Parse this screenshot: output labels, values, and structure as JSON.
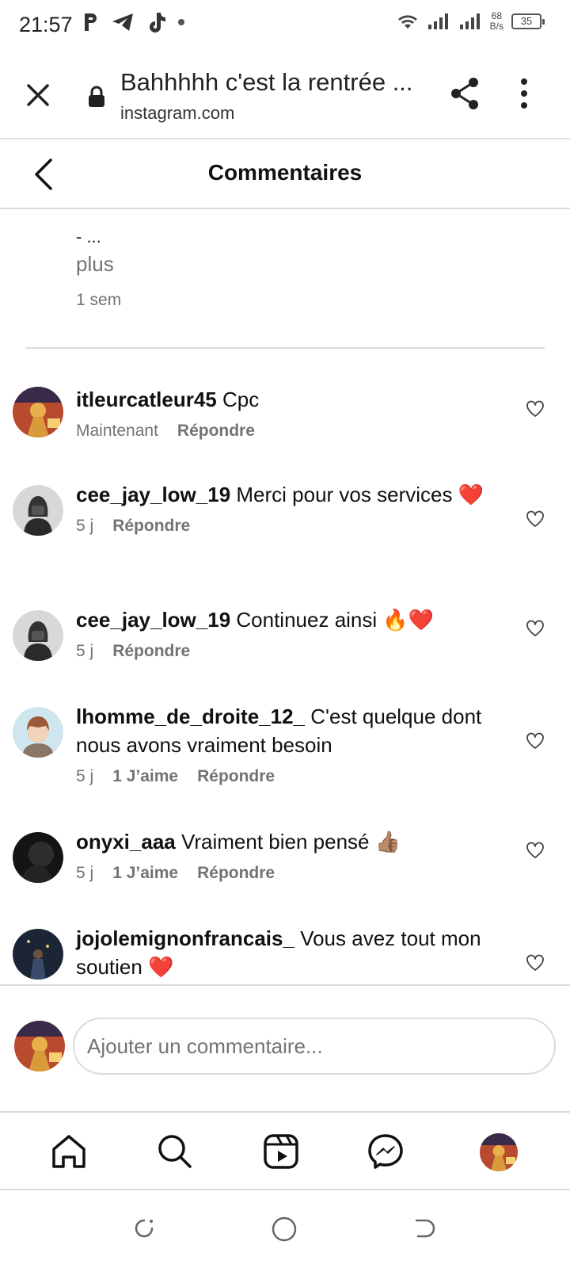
{
  "status_bar": {
    "time": "21:57",
    "net_speed_value": "68",
    "net_speed_unit": "B/s",
    "battery": "35"
  },
  "browser": {
    "page_title": "Bahhhhh c'est la rentrée ...",
    "domain": "instagram.com"
  },
  "header": {
    "title": "Commentaires"
  },
  "caption": {
    "snippet": "- ...",
    "more_label": "plus",
    "time": "1 sem"
  },
  "comments": [
    {
      "username": "itleurcatleur45",
      "text": "Cpc",
      "time": "Maintenant",
      "likes": "",
      "reply_label": "Répondre"
    },
    {
      "username": "cee_jay_low_19",
      "text": "Merci pour vos services ❤️",
      "time": "5 j",
      "likes": "",
      "reply_label": "Répondre"
    },
    {
      "username": "cee_jay_low_19",
      "text": "Continuez ainsi 🔥❤️",
      "time": "5 j",
      "likes": "",
      "reply_label": "Répondre"
    },
    {
      "username": "lhomme_de_droite_12_",
      "text": "C'est quelque dont nous avons vraiment besoin",
      "time": "5 j",
      "likes": "1 J’aime",
      "reply_label": "Répondre"
    },
    {
      "username": "onyxi_aaa",
      "text": "Vraiment bien pensé 👍🏽",
      "time": "5 j",
      "likes": "1 J’aime",
      "reply_label": "Répondre"
    },
    {
      "username": "jojolemignonfrancais_",
      "text": "Vous avez tout mon soutien ❤️",
      "time": "",
      "likes": "",
      "reply_label": ""
    }
  ],
  "add_comment": {
    "placeholder": "Ajouter un commentaire..."
  },
  "icons": {
    "close": "close-icon",
    "lock": "lock-icon",
    "share": "share-icon",
    "more": "more-vert-icon",
    "back": "chevron-left-icon",
    "heart": "heart-outline-icon",
    "home": "home-icon",
    "search": "search-icon",
    "reels": "reels-icon",
    "messenger": "messenger-icon"
  },
  "colors": {
    "text": "#111111",
    "secondary": "#737373",
    "divider": "#dbdbdb"
  }
}
